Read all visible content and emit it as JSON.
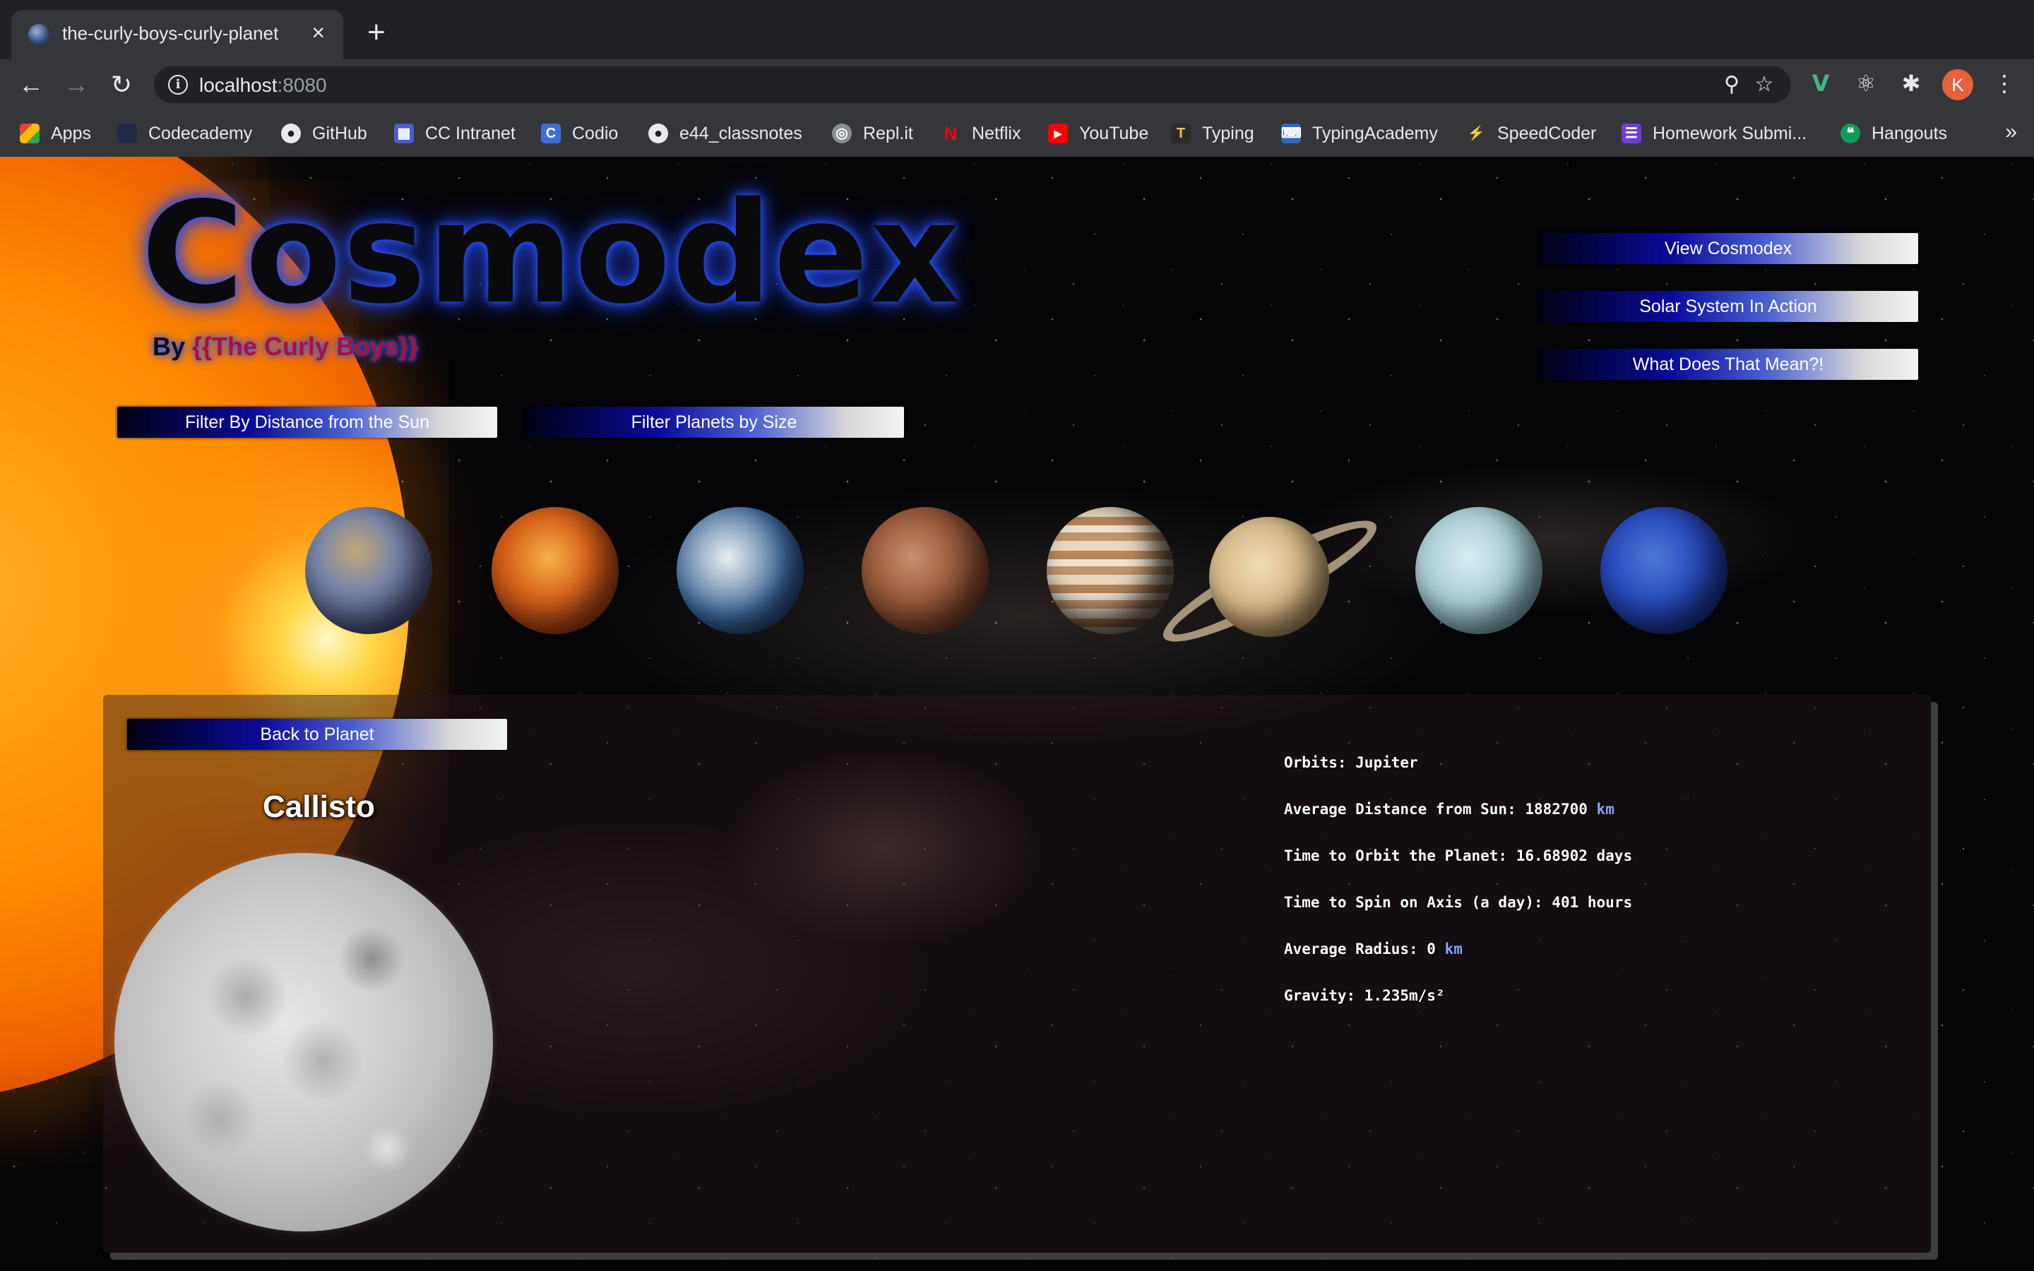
{
  "browser": {
    "tab_title": "the-curly-boys-curly-planet",
    "url_host": "localhost",
    "url_port": ":8080",
    "bookmarks": [
      {
        "label": "Apps",
        "icon": "apps-grid-icon"
      },
      {
        "label": "Codecademy",
        "icon": "codecademy-icon"
      },
      {
        "label": "GitHub",
        "icon": "github-icon"
      },
      {
        "label": "CC Intranet",
        "icon": "intranet-icon"
      },
      {
        "label": "Codio",
        "icon": "codio-icon"
      },
      {
        "label": "e44_classnotes",
        "icon": "github-icon"
      },
      {
        "label": "Repl.it",
        "icon": "replit-icon"
      },
      {
        "label": "Netflix",
        "icon": "netflix-icon"
      },
      {
        "label": "YouTube",
        "icon": "youtube-icon"
      },
      {
        "label": "Typing",
        "icon": "typing-icon"
      },
      {
        "label": "TypingAcademy",
        "icon": "typingacademy-icon"
      },
      {
        "label": "SpeedCoder",
        "icon": "speedcoder-icon"
      },
      {
        "label": "Homework Submi...",
        "icon": "homework-icon"
      },
      {
        "label": "Hangouts",
        "icon": "hangouts-icon"
      }
    ],
    "more_bookmarks": "»",
    "profile_initial": "K"
  },
  "header": {
    "title": "Cosmodex",
    "subtitle_prefix": "By ",
    "subtitle_accent": "{{The Curly Boys}}"
  },
  "nav": {
    "view_cosmodex": "View Cosmodex",
    "solar_system": "Solar System In Action",
    "what_does": "What Does That Mean?!"
  },
  "filters": {
    "by_distance": "Filter By Distance from the Sun",
    "by_size": "Filter Planets by Size"
  },
  "planets": [
    "mercury",
    "venus",
    "earth",
    "mars",
    "jupiter",
    "saturn",
    "uranus",
    "neptune"
  ],
  "detail": {
    "back_label": "Back to Planet",
    "name": "Callisto",
    "orbits_label": "Orbits: ",
    "orbits_value": "Jupiter",
    "distance_label": "Average Distance from Sun: ",
    "distance_value": "1882700",
    "distance_unit": "km",
    "orbit_time_label": "Time to Orbit the Planet: ",
    "orbit_time_value": "16.68902 days",
    "spin_label": "Time to Spin on Axis (a day): ",
    "spin_value": "401 hours",
    "radius_label": "Average Radius: ",
    "radius_value": "0",
    "radius_unit": "km",
    "gravity_label": "Gravity: ",
    "gravity_value": "1.235m/s²"
  },
  "colors": {
    "accent_blue": "#0a0a9a",
    "unit_blue": "#8ea2ff",
    "logo_glow": "#2f5cff",
    "subtitle_accent": "#b01030"
  }
}
